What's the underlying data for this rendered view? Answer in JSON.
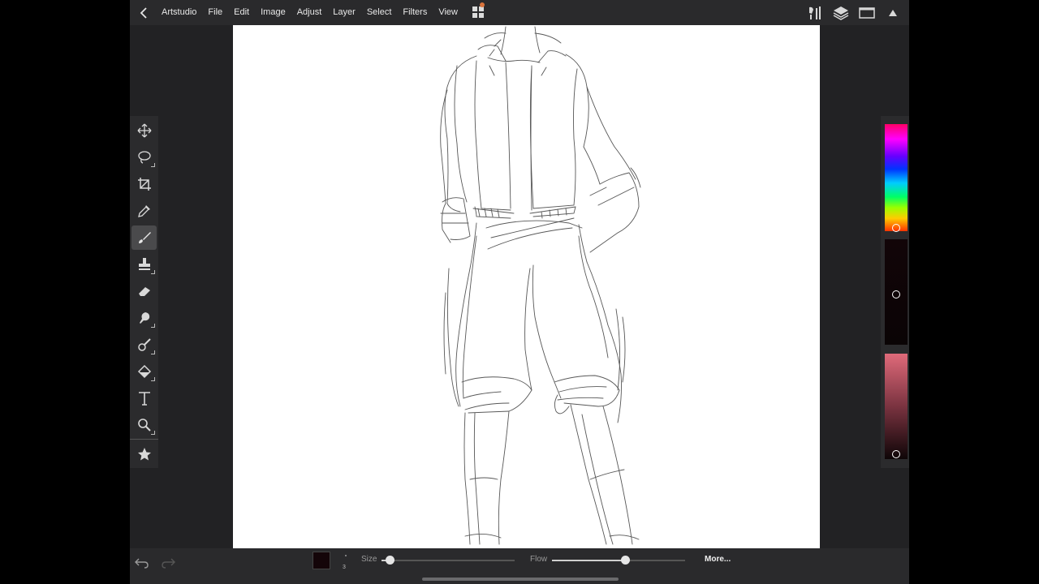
{
  "menubar": {
    "app_name": "Artstudio",
    "items": [
      "File",
      "Edit",
      "Image",
      "Adjust",
      "Layer",
      "Select",
      "Filters",
      "View"
    ]
  },
  "toolbar": {
    "tools": [
      {
        "name": "move-tool",
        "icon": "move-arrows-icon",
        "active": false
      },
      {
        "name": "lasso-tool",
        "icon": "lasso-icon",
        "active": false
      },
      {
        "name": "crop-tool",
        "icon": "crop-icon",
        "active": false
      },
      {
        "name": "eyedropper-tool",
        "icon": "eyedropper-icon",
        "active": false
      },
      {
        "name": "brush-tool",
        "icon": "brush-icon",
        "active": true
      },
      {
        "name": "stamp-tool",
        "icon": "stamp-icon",
        "active": false
      },
      {
        "name": "eraser-tool",
        "icon": "eraser-icon",
        "active": false
      },
      {
        "name": "smudge-tool",
        "icon": "smudge-icon",
        "active": false
      },
      {
        "name": "dodge-tool",
        "icon": "dodge-icon",
        "active": false
      },
      {
        "name": "fill-tool",
        "icon": "paint-bucket-icon",
        "active": false
      },
      {
        "name": "text-tool",
        "icon": "text-icon",
        "active": false
      },
      {
        "name": "zoom-tool",
        "icon": "magnifier-icon",
        "active": false
      },
      {
        "name": "favorites-tool",
        "icon": "star-icon",
        "active": false
      }
    ]
  },
  "color_panel": {
    "current_color": "#140509",
    "tint_color": "#e06a7a"
  },
  "bottombar": {
    "brush_size_number": "3",
    "size_label": "Size",
    "size_value": 0.06,
    "flow_label": "Flow",
    "flow_value": 0.55,
    "more_label": "More..."
  }
}
